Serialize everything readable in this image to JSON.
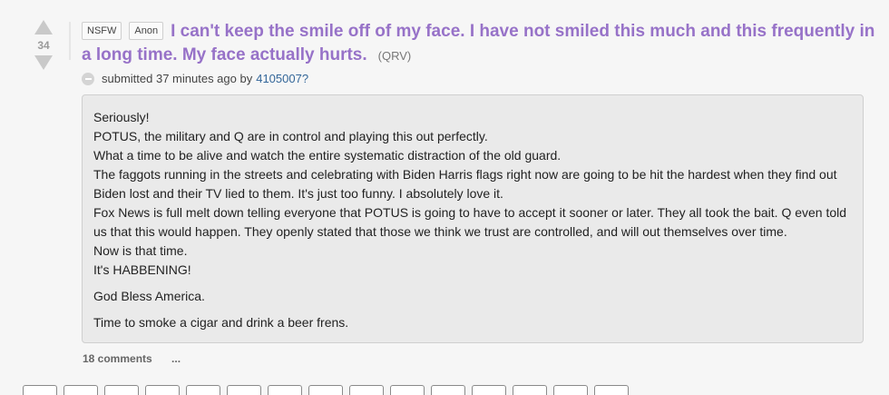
{
  "post": {
    "score": "34",
    "tags": [
      "NSFW",
      "Anon"
    ],
    "title": "I can't keep the smile off of my face. I have not smiled this much and this frequently in a long time. My face actually hurts.",
    "domain": "(QRV)",
    "submitted_text": "submitted 37 minutes ago by",
    "author": "4105007?"
  },
  "selftext": {
    "lines": [
      "Seriously!",
      "POTUS, the military and Q are in control and playing this out perfectly.",
      "What a time to be alive and watch the entire systematic distraction of the old guard.",
      "The faggots running in the streets and celebrating with Biden Harris flags right now are going to be hit the hardest when they find out Biden lost and their TV lied to them. It's just too funny. I absolutely love it.",
      "Fox News is full melt down telling everyone that POTUS is going to have to accept it sooner or later. They all took the bait. Q even told us that this would happen. They openly stated that those we think we trust are controlled, and will out themselves over time.",
      "Now is that time.",
      "It's HABBENING!"
    ],
    "closing_1": "God Bless America.",
    "closing_2": "Time to smoke a cigar and drink a beer frens."
  },
  "footer": {
    "comments": "18 comments",
    "more": "..."
  }
}
